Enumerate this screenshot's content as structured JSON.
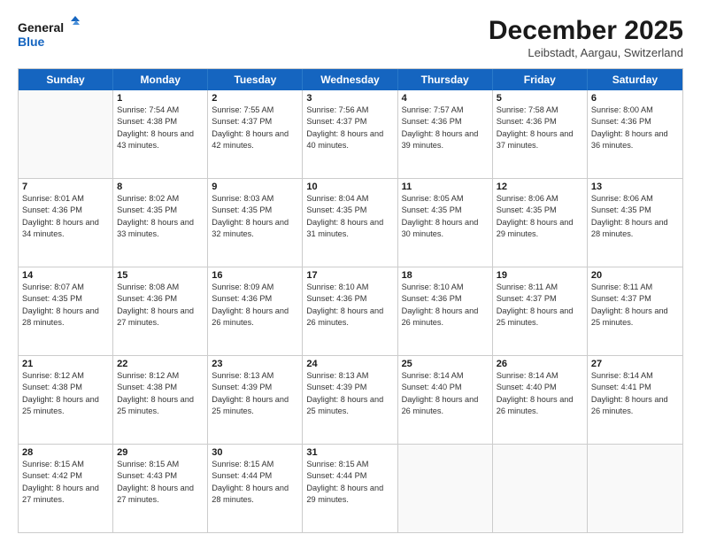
{
  "header": {
    "logo_line1": "General",
    "logo_line2": "Blue",
    "title": "December 2025",
    "subtitle": "Leibstadt, Aargau, Switzerland"
  },
  "weekdays": [
    "Sunday",
    "Monday",
    "Tuesday",
    "Wednesday",
    "Thursday",
    "Friday",
    "Saturday"
  ],
  "rows": [
    [
      {
        "num": "",
        "sunrise": "",
        "sunset": "",
        "daylight": ""
      },
      {
        "num": "1",
        "sunrise": "Sunrise: 7:54 AM",
        "sunset": "Sunset: 4:38 PM",
        "daylight": "Daylight: 8 hours and 43 minutes."
      },
      {
        "num": "2",
        "sunrise": "Sunrise: 7:55 AM",
        "sunset": "Sunset: 4:37 PM",
        "daylight": "Daylight: 8 hours and 42 minutes."
      },
      {
        "num": "3",
        "sunrise": "Sunrise: 7:56 AM",
        "sunset": "Sunset: 4:37 PM",
        "daylight": "Daylight: 8 hours and 40 minutes."
      },
      {
        "num": "4",
        "sunrise": "Sunrise: 7:57 AM",
        "sunset": "Sunset: 4:36 PM",
        "daylight": "Daylight: 8 hours and 39 minutes."
      },
      {
        "num": "5",
        "sunrise": "Sunrise: 7:58 AM",
        "sunset": "Sunset: 4:36 PM",
        "daylight": "Daylight: 8 hours and 37 minutes."
      },
      {
        "num": "6",
        "sunrise": "Sunrise: 8:00 AM",
        "sunset": "Sunset: 4:36 PM",
        "daylight": "Daylight: 8 hours and 36 minutes."
      }
    ],
    [
      {
        "num": "7",
        "sunrise": "Sunrise: 8:01 AM",
        "sunset": "Sunset: 4:36 PM",
        "daylight": "Daylight: 8 hours and 34 minutes."
      },
      {
        "num": "8",
        "sunrise": "Sunrise: 8:02 AM",
        "sunset": "Sunset: 4:35 PM",
        "daylight": "Daylight: 8 hours and 33 minutes."
      },
      {
        "num": "9",
        "sunrise": "Sunrise: 8:03 AM",
        "sunset": "Sunset: 4:35 PM",
        "daylight": "Daylight: 8 hours and 32 minutes."
      },
      {
        "num": "10",
        "sunrise": "Sunrise: 8:04 AM",
        "sunset": "Sunset: 4:35 PM",
        "daylight": "Daylight: 8 hours and 31 minutes."
      },
      {
        "num": "11",
        "sunrise": "Sunrise: 8:05 AM",
        "sunset": "Sunset: 4:35 PM",
        "daylight": "Daylight: 8 hours and 30 minutes."
      },
      {
        "num": "12",
        "sunrise": "Sunrise: 8:06 AM",
        "sunset": "Sunset: 4:35 PM",
        "daylight": "Daylight: 8 hours and 29 minutes."
      },
      {
        "num": "13",
        "sunrise": "Sunrise: 8:06 AM",
        "sunset": "Sunset: 4:35 PM",
        "daylight": "Daylight: 8 hours and 28 minutes."
      }
    ],
    [
      {
        "num": "14",
        "sunrise": "Sunrise: 8:07 AM",
        "sunset": "Sunset: 4:35 PM",
        "daylight": "Daylight: 8 hours and 28 minutes."
      },
      {
        "num": "15",
        "sunrise": "Sunrise: 8:08 AM",
        "sunset": "Sunset: 4:36 PM",
        "daylight": "Daylight: 8 hours and 27 minutes."
      },
      {
        "num": "16",
        "sunrise": "Sunrise: 8:09 AM",
        "sunset": "Sunset: 4:36 PM",
        "daylight": "Daylight: 8 hours and 26 minutes."
      },
      {
        "num": "17",
        "sunrise": "Sunrise: 8:10 AM",
        "sunset": "Sunset: 4:36 PM",
        "daylight": "Daylight: 8 hours and 26 minutes."
      },
      {
        "num": "18",
        "sunrise": "Sunrise: 8:10 AM",
        "sunset": "Sunset: 4:36 PM",
        "daylight": "Daylight: 8 hours and 26 minutes."
      },
      {
        "num": "19",
        "sunrise": "Sunrise: 8:11 AM",
        "sunset": "Sunset: 4:37 PM",
        "daylight": "Daylight: 8 hours and 25 minutes."
      },
      {
        "num": "20",
        "sunrise": "Sunrise: 8:11 AM",
        "sunset": "Sunset: 4:37 PM",
        "daylight": "Daylight: 8 hours and 25 minutes."
      }
    ],
    [
      {
        "num": "21",
        "sunrise": "Sunrise: 8:12 AM",
        "sunset": "Sunset: 4:38 PM",
        "daylight": "Daylight: 8 hours and 25 minutes."
      },
      {
        "num": "22",
        "sunrise": "Sunrise: 8:12 AM",
        "sunset": "Sunset: 4:38 PM",
        "daylight": "Daylight: 8 hours and 25 minutes."
      },
      {
        "num": "23",
        "sunrise": "Sunrise: 8:13 AM",
        "sunset": "Sunset: 4:39 PM",
        "daylight": "Daylight: 8 hours and 25 minutes."
      },
      {
        "num": "24",
        "sunrise": "Sunrise: 8:13 AM",
        "sunset": "Sunset: 4:39 PM",
        "daylight": "Daylight: 8 hours and 25 minutes."
      },
      {
        "num": "25",
        "sunrise": "Sunrise: 8:14 AM",
        "sunset": "Sunset: 4:40 PM",
        "daylight": "Daylight: 8 hours and 26 minutes."
      },
      {
        "num": "26",
        "sunrise": "Sunrise: 8:14 AM",
        "sunset": "Sunset: 4:40 PM",
        "daylight": "Daylight: 8 hours and 26 minutes."
      },
      {
        "num": "27",
        "sunrise": "Sunrise: 8:14 AM",
        "sunset": "Sunset: 4:41 PM",
        "daylight": "Daylight: 8 hours and 26 minutes."
      }
    ],
    [
      {
        "num": "28",
        "sunrise": "Sunrise: 8:15 AM",
        "sunset": "Sunset: 4:42 PM",
        "daylight": "Daylight: 8 hours and 27 minutes."
      },
      {
        "num": "29",
        "sunrise": "Sunrise: 8:15 AM",
        "sunset": "Sunset: 4:43 PM",
        "daylight": "Daylight: 8 hours and 27 minutes."
      },
      {
        "num": "30",
        "sunrise": "Sunrise: 8:15 AM",
        "sunset": "Sunset: 4:44 PM",
        "daylight": "Daylight: 8 hours and 28 minutes."
      },
      {
        "num": "31",
        "sunrise": "Sunrise: 8:15 AM",
        "sunset": "Sunset: 4:44 PM",
        "daylight": "Daylight: 8 hours and 29 minutes."
      },
      {
        "num": "",
        "sunrise": "",
        "sunset": "",
        "daylight": ""
      },
      {
        "num": "",
        "sunrise": "",
        "sunset": "",
        "daylight": ""
      },
      {
        "num": "",
        "sunrise": "",
        "sunset": "",
        "daylight": ""
      }
    ]
  ]
}
